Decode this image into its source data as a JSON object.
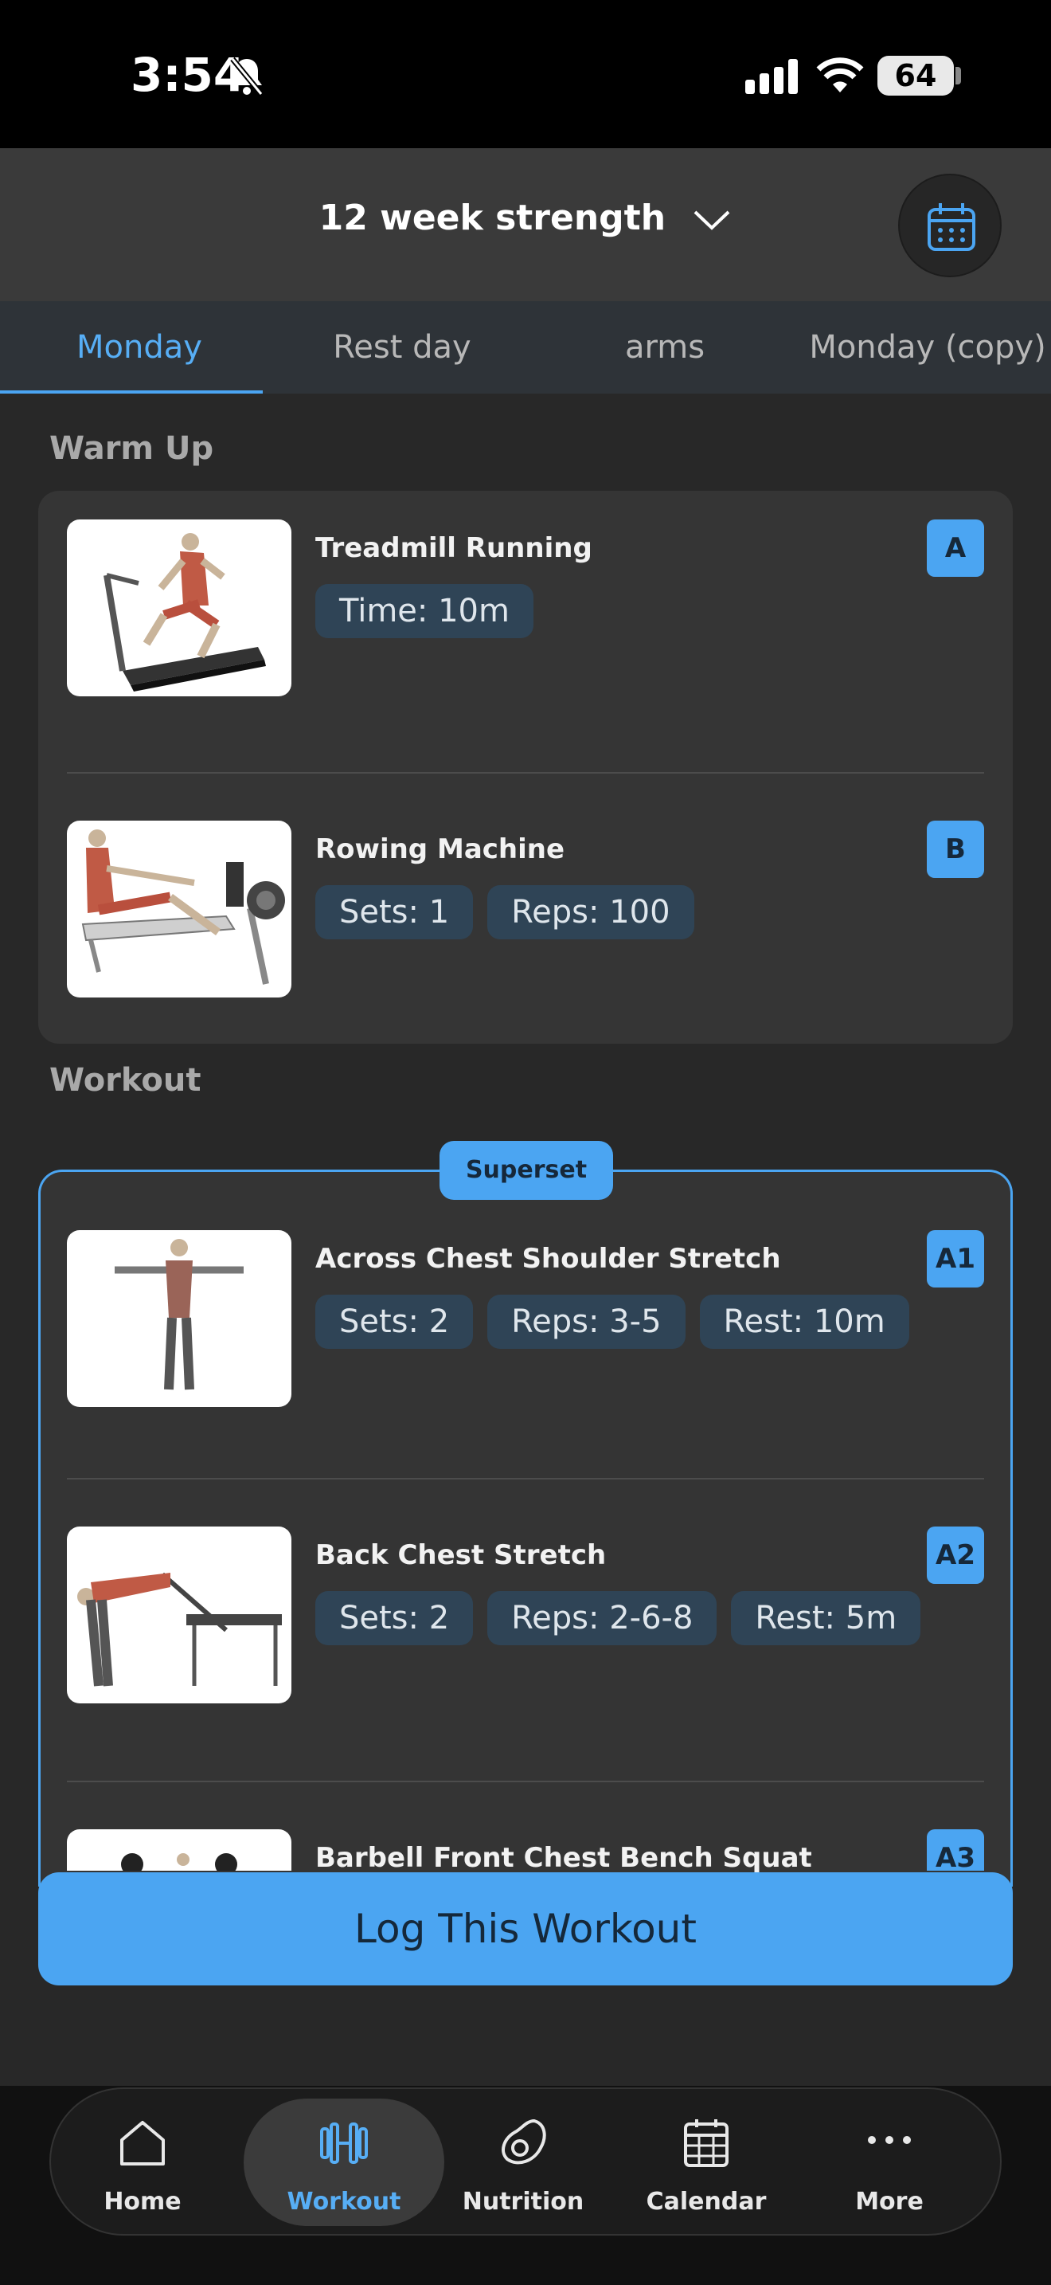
{
  "status_bar": {
    "time": "3:54",
    "battery": "64"
  },
  "header": {
    "program": "12 week strength"
  },
  "tabs": [
    "Monday",
    "Rest day",
    "arms",
    "Monday (copy)"
  ],
  "sections": {
    "warmup": "Warm Up",
    "workout": "Workout"
  },
  "warmup": [
    {
      "name": "Treadmill Running",
      "letter": "A",
      "chips": [
        "Time: 10m"
      ]
    },
    {
      "name": "Rowing Machine",
      "letter": "B",
      "chips": [
        "Sets: 1",
        "Reps: 100"
      ]
    }
  ],
  "superset": {
    "badge": "Superset",
    "items": [
      {
        "name": "Across Chest Shoulder Stretch",
        "letter": "A1",
        "chips": [
          "Sets: 2",
          "Reps: 3-5",
          "Rest: 10m"
        ]
      },
      {
        "name": "Back Chest Stretch",
        "letter": "A2",
        "chips": [
          "Sets: 2",
          "Reps: 2-6-8",
          "Rest: 5m"
        ]
      },
      {
        "name": "Barbell Front Chest Bench Squat",
        "letter": "A3"
      }
    ]
  },
  "log_button": "Log This Workout",
  "nav": [
    {
      "label": "Home",
      "icon": "home-icon"
    },
    {
      "label": "Workout",
      "icon": "dumbbell-icon"
    },
    {
      "label": "Nutrition",
      "icon": "avocado-icon"
    },
    {
      "label": "Calendar",
      "icon": "calendar-icon"
    },
    {
      "label": "More",
      "icon": "more-icon"
    }
  ],
  "colors": {
    "accent": "#4ba5f2",
    "chip": "#2f4456",
    "card": "#353535",
    "background": "#282828"
  }
}
